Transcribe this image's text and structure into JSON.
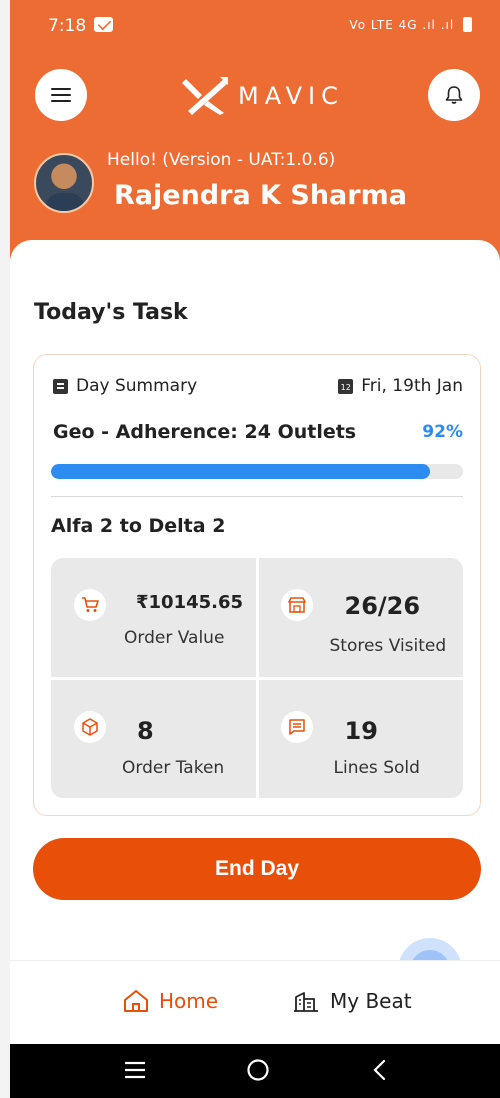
{
  "status_bar": {
    "time": "7:18",
    "network": "Vo LTE 4G",
    "signal_text": ".ıl .ıl"
  },
  "header": {
    "brand": "MAVIC",
    "greeting": "Hello! (Version - UAT:1.0.6)",
    "user_name": "Rajendra K Sharma"
  },
  "task": {
    "title": "Today's Task",
    "summary_label": "Day Summary",
    "date": "Fri, 19th Jan",
    "geo_label": "Geo - Adherence: 24 Outlets",
    "geo_percent": "92%",
    "geo_progress": 0.92,
    "beat": "Alfa 2 to Delta 2",
    "stats": {
      "order_value": {
        "value": "₹10145.65",
        "label": "Order Value",
        "icon": "cart-icon"
      },
      "stores_visited": {
        "value": "26/26",
        "label": "Stores Visited",
        "icon": "store-icon"
      },
      "order_taken": {
        "value": "8",
        "label": "Order Taken",
        "icon": "box-icon"
      },
      "lines_sold": {
        "value": "19",
        "label": "Lines Sold",
        "icon": "receipt-icon"
      }
    }
  },
  "actions": {
    "end_day": "End Day"
  },
  "help": {
    "label": "?"
  },
  "bottom_nav": {
    "home": "Home",
    "my_beat": "My Beat"
  },
  "colors": {
    "primary": "#ec6c34",
    "button": "#e8500a",
    "progress": "#2d8cf0",
    "tile": "#e9e9e9"
  }
}
